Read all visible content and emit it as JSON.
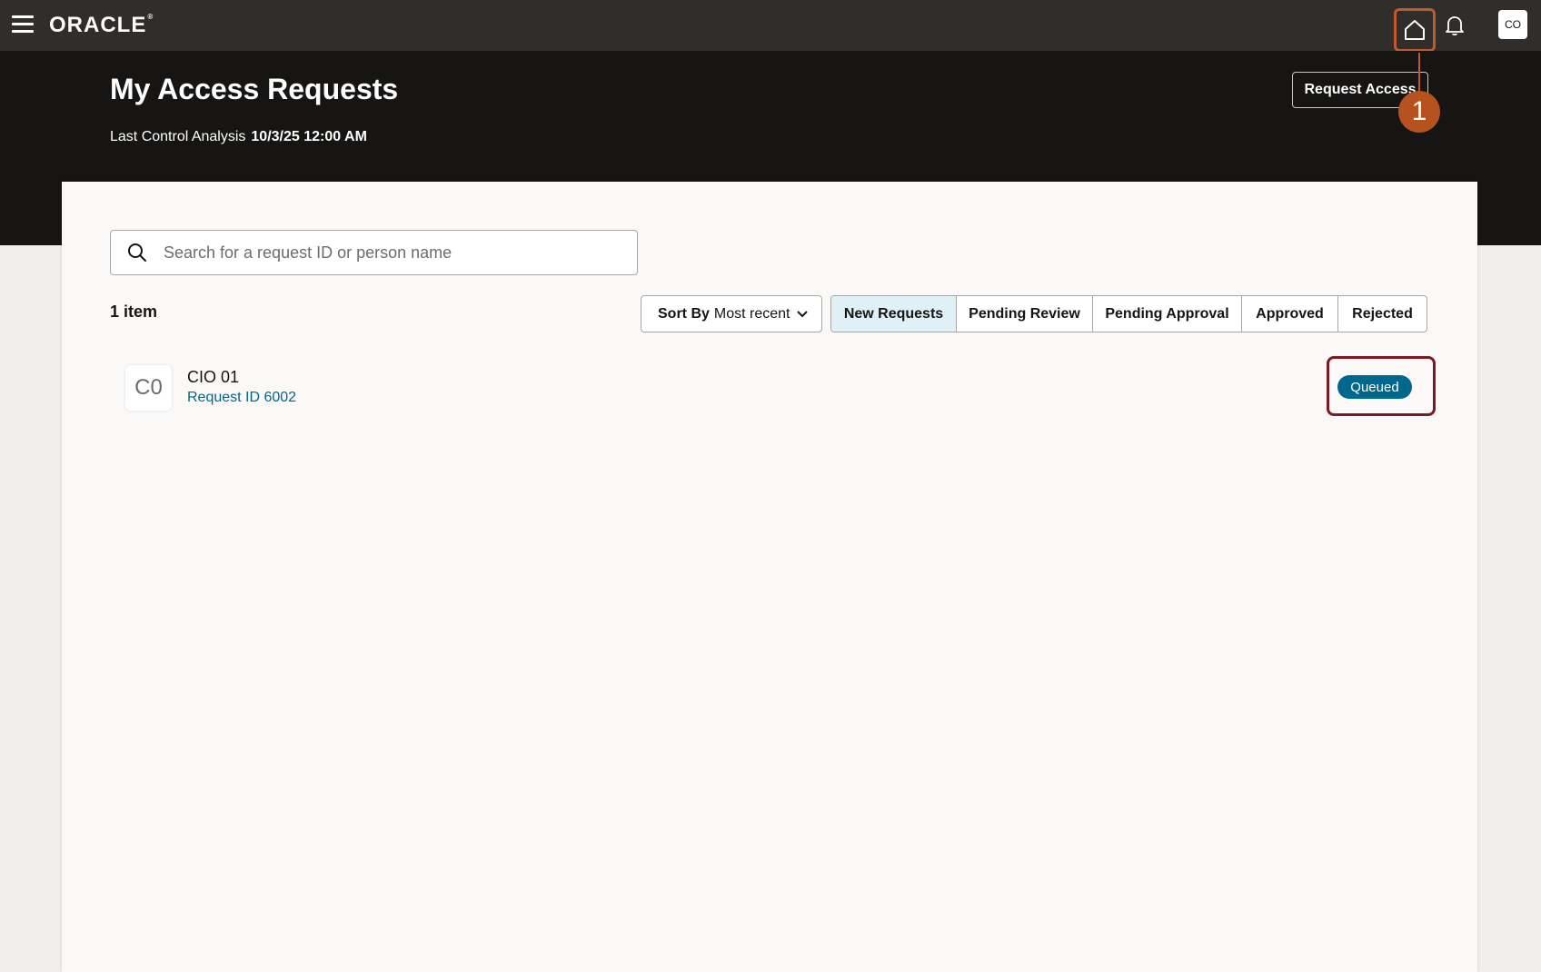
{
  "topbar": {
    "logo_text": "ORACLE",
    "user_initials": "CO"
  },
  "header": {
    "title": "My Access Requests",
    "last_analysis_label": "Last Control Analysis",
    "last_analysis_value": "10/3/25 12:00 AM",
    "request_access_label": "Request Access"
  },
  "callout": {
    "number": "1"
  },
  "search": {
    "placeholder": "Search for a request ID or person name",
    "value": ""
  },
  "results": {
    "count_label": "1 item"
  },
  "sort": {
    "label": "Sort By",
    "value": "Most recent"
  },
  "tabs": [
    {
      "label": "New Requests",
      "active": true
    },
    {
      "label": "Pending Review",
      "active": false
    },
    {
      "label": "Pending Approval",
      "active": false
    },
    {
      "label": "Approved",
      "active": false
    },
    {
      "label": "Rejected",
      "active": false
    }
  ],
  "requests": [
    {
      "initials": "C0",
      "name": "CIO 01",
      "request_id": "Request ID 6002",
      "status": "Queued"
    }
  ],
  "colors": {
    "topbar": "#312d2a",
    "header": "#161513",
    "accent": "#00688c",
    "callout": "#b5521e",
    "highlight_box": "#7a1a22"
  },
  "icons": [
    "hamburger-menu-icon",
    "home-icon",
    "bell-icon",
    "search-icon",
    "chevron-down-icon"
  ]
}
